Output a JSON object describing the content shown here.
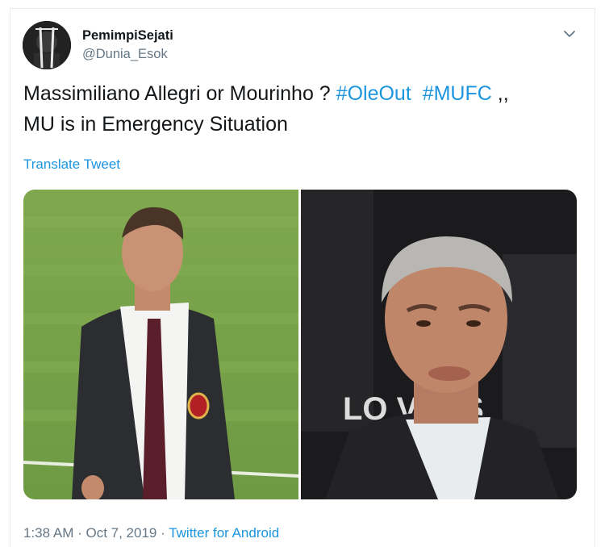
{
  "author": {
    "display_name": "PemimpiSejati",
    "handle": "@Dunia_Esok"
  },
  "tweet": {
    "text_line1_prefix": "Massimiliano Allegri or Mourinho ? ",
    "hashtag_1": "#OleOut",
    "hashtag_2": "#MUFC",
    "text_line1_suffix": " ,,",
    "text_line2": "MU is in Emergency Situation",
    "translate_label": "Translate Tweet"
  },
  "media": {
    "image_right_banner_text": "LO      VANS"
  },
  "meta": {
    "time": "1:38 AM",
    "separator": " · ",
    "date": "Oct 7, 2019",
    "source": "Twitter for Android"
  },
  "colors": {
    "link": "#1b95e0",
    "secondary_text": "#657786",
    "primary_text": "#14171a"
  },
  "icons": [
    "avatar",
    "chevron-down-icon"
  ]
}
